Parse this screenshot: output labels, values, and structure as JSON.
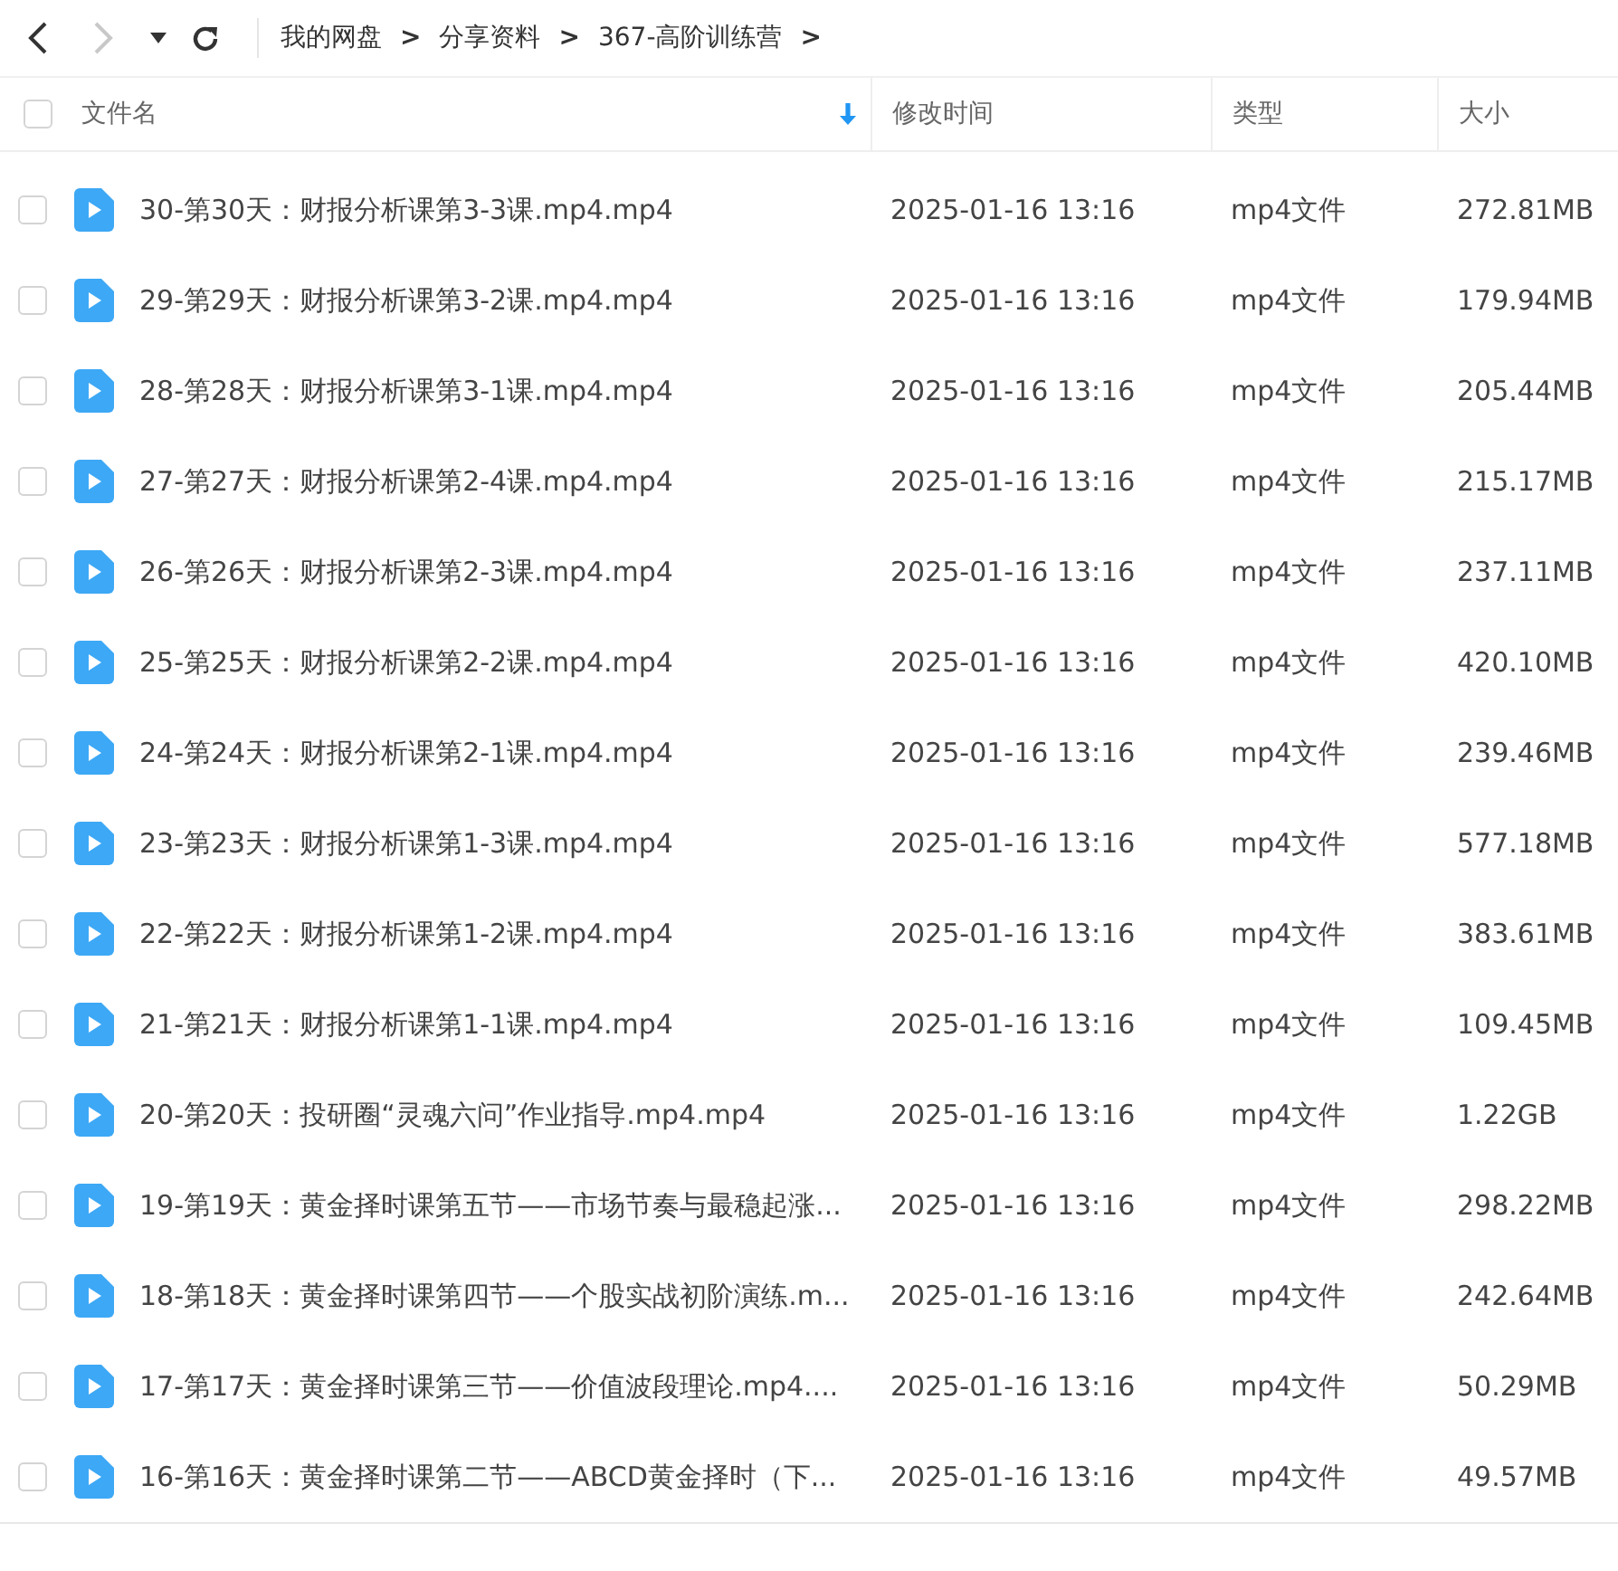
{
  "toolbar": {
    "back": {
      "disabled": false
    },
    "forward": {
      "disabled": true
    },
    "breadcrumb": [
      {
        "label": "我的网盘",
        "separator": ">"
      },
      {
        "label": "分享资料",
        "separator": ">"
      },
      {
        "label": "367-高阶训练营",
        "separator": ">"
      }
    ]
  },
  "table": {
    "select_all": {
      "checked": false
    },
    "columns": [
      {
        "label": "文件名",
        "sorted": true
      },
      {
        "label": "修改时间",
        "sorted": false
      },
      {
        "label": "类型",
        "sorted": false
      },
      {
        "label": "大小",
        "sorted": false
      }
    ],
    "rows": [
      {
        "checked": false,
        "name": "30-第30天：财报分析课第3-3课.mp4.mp4",
        "modified": "2025-01-16 13:16",
        "type": "mp4文件",
        "size": "272.81MB"
      },
      {
        "checked": false,
        "name": "29-第29天：财报分析课第3-2课.mp4.mp4",
        "modified": "2025-01-16 13:16",
        "type": "mp4文件",
        "size": "179.94MB"
      },
      {
        "checked": false,
        "name": "28-第28天：财报分析课第3-1课.mp4.mp4",
        "modified": "2025-01-16 13:16",
        "type": "mp4文件",
        "size": "205.44MB"
      },
      {
        "checked": false,
        "name": "27-第27天：财报分析课第2-4课.mp4.mp4",
        "modified": "2025-01-16 13:16",
        "type": "mp4文件",
        "size": "215.17MB"
      },
      {
        "checked": false,
        "name": "26-第26天：财报分析课第2-3课.mp4.mp4",
        "modified": "2025-01-16 13:16",
        "type": "mp4文件",
        "size": "237.11MB"
      },
      {
        "checked": false,
        "name": "25-第25天：财报分析课第2-2课.mp4.mp4",
        "modified": "2025-01-16 13:16",
        "type": "mp4文件",
        "size": "420.10MB"
      },
      {
        "checked": false,
        "name": "24-第24天：财报分析课第2-1课.mp4.mp4",
        "modified": "2025-01-16 13:16",
        "type": "mp4文件",
        "size": "239.46MB"
      },
      {
        "checked": false,
        "name": "23-第23天：财报分析课第1-3课.mp4.mp4",
        "modified": "2025-01-16 13:16",
        "type": "mp4文件",
        "size": "577.18MB"
      },
      {
        "checked": false,
        "name": "22-第22天：财报分析课第1-2课.mp4.mp4",
        "modified": "2025-01-16 13:16",
        "type": "mp4文件",
        "size": "383.61MB"
      },
      {
        "checked": false,
        "name": "21-第21天：财报分析课第1-1课.mp4.mp4",
        "modified": "2025-01-16 13:16",
        "type": "mp4文件",
        "size": "109.45MB"
      },
      {
        "checked": false,
        "name": "20-第20天：投研圈“灵魂六问”作业指导.mp4.mp4",
        "modified": "2025-01-16 13:16",
        "type": "mp4文件",
        "size": "1.22GB"
      },
      {
        "checked": false,
        "name": "19-第19天：黄金择时课第五节——市场节奏与最稳起涨...",
        "modified": "2025-01-16 13:16",
        "type": "mp4文件",
        "size": "298.22MB"
      },
      {
        "checked": false,
        "name": "18-第18天：黄金择时课第四节——个股实战初阶演练.m...",
        "modified": "2025-01-16 13:16",
        "type": "mp4文件",
        "size": "242.64MB"
      },
      {
        "checked": false,
        "name": "17-第17天：黄金择时课第三节——价值波段理论.mp4....",
        "modified": "2025-01-16 13:16",
        "type": "mp4文件",
        "size": "50.29MB"
      },
      {
        "checked": false,
        "name": "16-第16天：黄金择时课第二节——ABCD黄金择时（下...",
        "modified": "2025-01-16 13:16",
        "type": "mp4文件",
        "size": "49.57MB"
      }
    ]
  }
}
